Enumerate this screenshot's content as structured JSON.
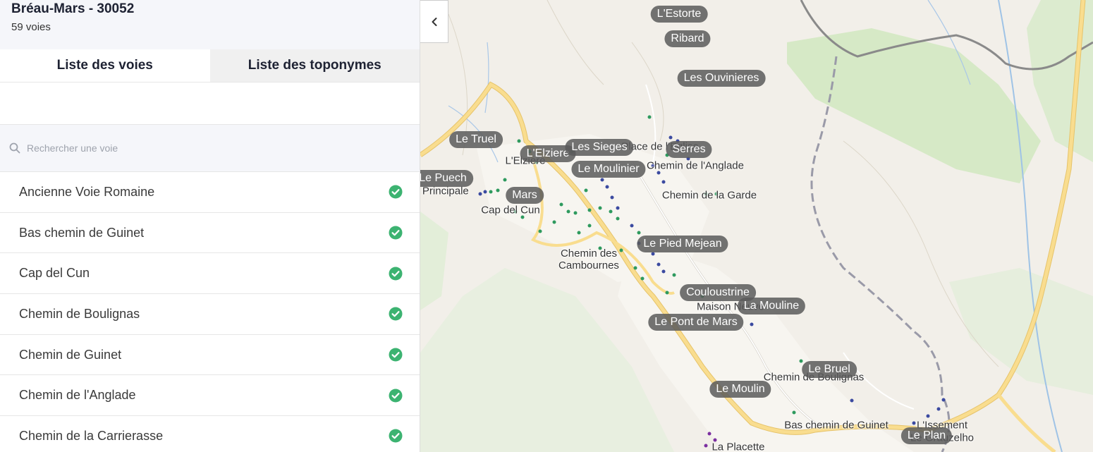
{
  "commune": {
    "title": "Bréau-Mars - 30052",
    "count": "59 voies"
  },
  "tabs": [
    {
      "label": "Liste des voies",
      "active": true
    },
    {
      "label": "Liste des toponymes",
      "active": false
    }
  ],
  "search": {
    "placeholder": "Rechercher une voie",
    "value": ""
  },
  "voies": [
    "Ancienne Voie Romaine",
    "Bas chemin de Guinet",
    "Cap del Cun",
    "Chemin de Boulignas",
    "Chemin de Guinet",
    "Chemin de l'Anglade",
    "Chemin de la Carrierasse"
  ],
  "icons": {
    "search": "search-icon",
    "check": "check-circle-icon",
    "collapse": "chevron-left-icon"
  },
  "colors": {
    "check": "#3cb371",
    "toponym_bg": "#5a5a5a",
    "road": "#f7d27a",
    "forest": "#d4e8c4",
    "dot_green": "#2e9a5e",
    "dot_blue": "#3b4aa0",
    "dot_purple": "#7b2fa0"
  },
  "map": {
    "toponyms": [
      {
        "label": "L'Estorte"
      },
      {
        "label": "Ribard"
      },
      {
        "label": "Les Ouvinieres"
      },
      {
        "label": "Le Truel"
      },
      {
        "label": "L'Elziere"
      },
      {
        "label": "Les Sieges"
      },
      {
        "label": "Serres"
      },
      {
        "label": "Le Moulinier"
      },
      {
        "label": "Le Puech"
      },
      {
        "label": "Mars"
      },
      {
        "label": "Le Pied Mejean"
      },
      {
        "label": "Couloustrine"
      },
      {
        "label": "La Mouline"
      },
      {
        "label": "Le Pont de Mars"
      },
      {
        "label": "Le Bruel"
      },
      {
        "label": "Le Moulin"
      },
      {
        "label": "Le Plan"
      }
    ],
    "streets": [
      {
        "label": "L'Elziere"
      },
      {
        "label": "Place de l'Eglise"
      },
      {
        "label": "Chemin de l'Anglade"
      },
      {
        "label": "Chemin de la Garde"
      },
      {
        "label": "Rue Principale"
      },
      {
        "label": "Cap del Cun"
      },
      {
        "label": "Chemin des Cambournes"
      },
      {
        "label": "Maison Neuve"
      },
      {
        "label": "Chemin de Boulignas"
      },
      {
        "label": "Bas chemin de Guinet"
      },
      {
        "label": "L'Issement"
      },
      {
        "label": "Le Grauzelho"
      },
      {
        "label": "La Placette"
      }
    ]
  }
}
